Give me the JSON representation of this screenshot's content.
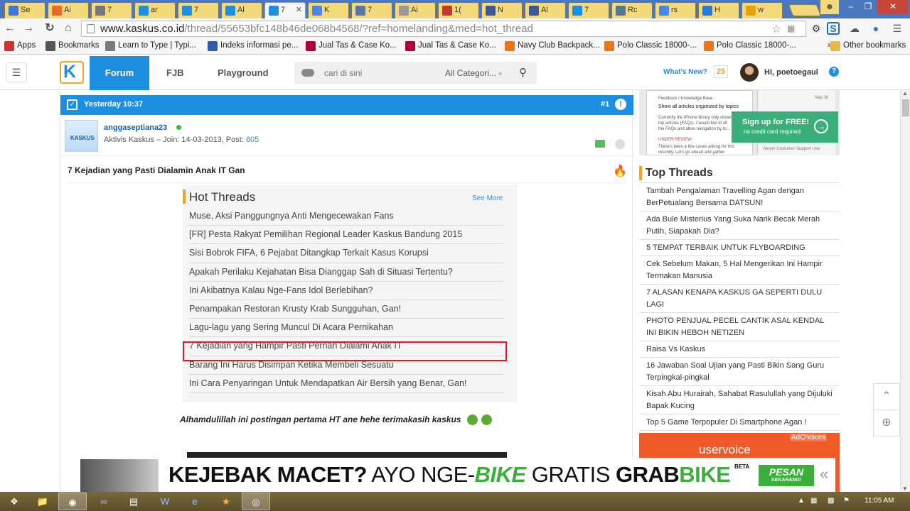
{
  "browser": {
    "tabs": [
      {
        "label": "Se",
        "icon_color": "#3d7ad8"
      },
      {
        "label": "Ai",
        "icon_color": "#e86a2c"
      },
      {
        "label": "7",
        "icon_color": "#777777"
      },
      {
        "label": "ar",
        "icon_color": "#1d8fe1"
      },
      {
        "label": "7",
        "icon_color": "#1d8fe1"
      },
      {
        "label": "Al",
        "icon_color": "#1d8fe1"
      },
      {
        "label": "7",
        "icon_color": "#1d8fe1",
        "active": true
      },
      {
        "label": "K",
        "icon_color": "#4a86e8"
      },
      {
        "label": "7",
        "icon_color": "#5577aa"
      },
      {
        "label": "Ai",
        "icon_color": "#999999"
      },
      {
        "label": "1(",
        "icon_color": "#c0392b"
      },
      {
        "label": "N",
        "icon_color": "#3b5998"
      },
      {
        "label": "Al",
        "icon_color": "#3b5998"
      },
      {
        "label": "7",
        "icon_color": "#1d8fe1"
      },
      {
        "label": "Rc",
        "icon_color": "#557799"
      },
      {
        "label": "rs",
        "icon_color": "#4a86e8"
      },
      {
        "label": "H",
        "icon_color": "#2a7ad8"
      },
      {
        "label": "w",
        "icon_color": "#e8a400"
      }
    ],
    "url_host": "www.kaskus.co.id",
    "url_path": "/thread/55653bfc148b46de068b4568/?ref=homelanding&med=hot_thread",
    "bookmarks": [
      {
        "label": "Apps",
        "icon": "apps-icon",
        "color": "#cc3333"
      },
      {
        "label": "Bookmarks",
        "icon": "star-icon",
        "color": "#555555"
      },
      {
        "label": "Learn to Type | Typi...",
        "icon": "typing-icon",
        "color": "#7a7a7a"
      },
      {
        "label": "Indeks informasi pe...",
        "icon": "info-icon",
        "color": "#2a5db0"
      },
      {
        "label": "Jual Tas & Case Ko...",
        "icon": "bl-icon",
        "color": "#b0003a"
      },
      {
        "label": "Jual Tas & Case Ko...",
        "icon": "bl-icon",
        "color": "#b0003a"
      },
      {
        "label": "Navy Club Backpack...",
        "icon": "shop-icon",
        "color": "#e8761a"
      },
      {
        "label": "Polo Classic 18000-...",
        "icon": "shop-icon",
        "color": "#e8761a"
      },
      {
        "label": "Polo Classic 18000-...",
        "icon": "shop-icon",
        "color": "#e8761a"
      }
    ],
    "bookmarks_more": "»",
    "other_bookmarks": "Other bookmarks"
  },
  "header": {
    "logo_letter": "K",
    "nav_forum": "Forum",
    "nav_fjb": "FJB",
    "nav_playground": "Playground",
    "search_placeholder": "cari di sini",
    "search_category": "All Categori...",
    "whats_new": "What's New?",
    "whats_new_count": "25",
    "greeting": "Hi, poetoegaul",
    "accent": "#1d8fe1",
    "brand_orange": "#f3a31d"
  },
  "post": {
    "timestamp": "Yesterday 10:37",
    "number": "#1",
    "username": "anggaseptiana23",
    "avatar_text": "KASKUS",
    "user_meta_prefix": "Aktivis Kaskus – Join: 14-03-2013, Post: ",
    "post_count": "605",
    "title": "7 Kejadian yang Pasti Dialamin Anak IT Gan",
    "hot_threads_title": "Hot Threads",
    "see_more": "See More",
    "hot_threads": [
      "Muse, Aksi Panggungnya Anti Mengecewakan Fans",
      "[FR] Pesta Rakyat Pemilihan Regional Leader Kaskus Bandung 2015",
      "Sisi Bobrok FIFA, 6 Pejabat Ditangkap Terkait Kasus Korupsi",
      "Apakah Perilaku Kejahatan Bisa Dianggap Sah di Situasi Tertentu?",
      "Ini Akibatnya Kalau Nge-Fans Idol Berlebihan?",
      "Penampakan Restoran Krusty Krab Sungguhan, Gan!",
      "Lagu-lagu yang Sering Muncul Di Acara Pernikahan",
      "7 Kejadian yang Hampir Pasti Pernah Dialami Anak IT",
      "Barang Ini Harus Disimpan Ketika Membeli Sesuatu",
      "Ini Cara Penyaringan Untuk Mendapatkan Air Bersih yang Benar, Gan!"
    ],
    "highlighted_index": 7,
    "highlight_color": "#e01b1b",
    "footnote": "Alhamdulillah ini postingan pertama HT ane hehe terimakasih kaskus"
  },
  "sidebar": {
    "promo_line1": "Feedback / Knowledge Base",
    "promo_line2": "Show all articles organized by topics",
    "promo_line3": "Currently the iPhone library only shows",
    "promo_line4": "top articles (FAQs). I would like to sh",
    "promo_line5": "the FAQs and allow navigation by to...",
    "promo_line6": "UNDER REVIEW",
    "promo_line7": "There's been a few cases asking for this",
    "promo_line8": "recently. Let's go ahead and gather",
    "promo_right1": "Sep 16",
    "promo_right2": "Moyer Customer Support Use",
    "signup_title": "Sign up for FREE!",
    "signup_sub": "no credit card required",
    "top_threads_title": "Top Threads",
    "top_threads": [
      "Tambah Pengalaman Travelling Agan dengan BerPetualang Bersama DATSUN!",
      "Ada Bule Misterius Yang Suka Narik Becak Merah Putih, Siapakah Dia?",
      "5 TEMPAT TERBAIK UNTUK FLYBOARDING",
      "Cek Sebelum Makan, 5 Hal Mengerikan Ini Hampir Termakan Manusia",
      "7 ALASAN KENAPA KASKUS GA SEPERTI DULU LAGI",
      "PHOTO PENJUAL PECEL CANTIK ASAL KENDAL INI BIKIN HEBOH NETIZEN",
      "Raisa Vs Kaskus",
      "16 Jawaban Soal Ujian yang Pasti Bikin Sang Guru Terpingkal-pingkal",
      "Kisah Abu Hurairah, Sahabat Rasulullah yang Dijuluki Bapak Kucing",
      "Top 5 Game Terpopuler Di Smartphone Agan !"
    ],
    "adchoices": "AdChoices",
    "ad_brand": "uservoice"
  },
  "banner": {
    "part1": "KEJEBAK MACET?",
    "part2": " AYO NGE-",
    "part3": "BIKE",
    "part4": " GRATIS ",
    "part5": "GRAB",
    "part6": "BIKE",
    "beta": "BETA",
    "cta": "PESAN",
    "cta_sub": "SEKARANG!"
  },
  "taskbar": {
    "clock": "11:05 AM"
  }
}
